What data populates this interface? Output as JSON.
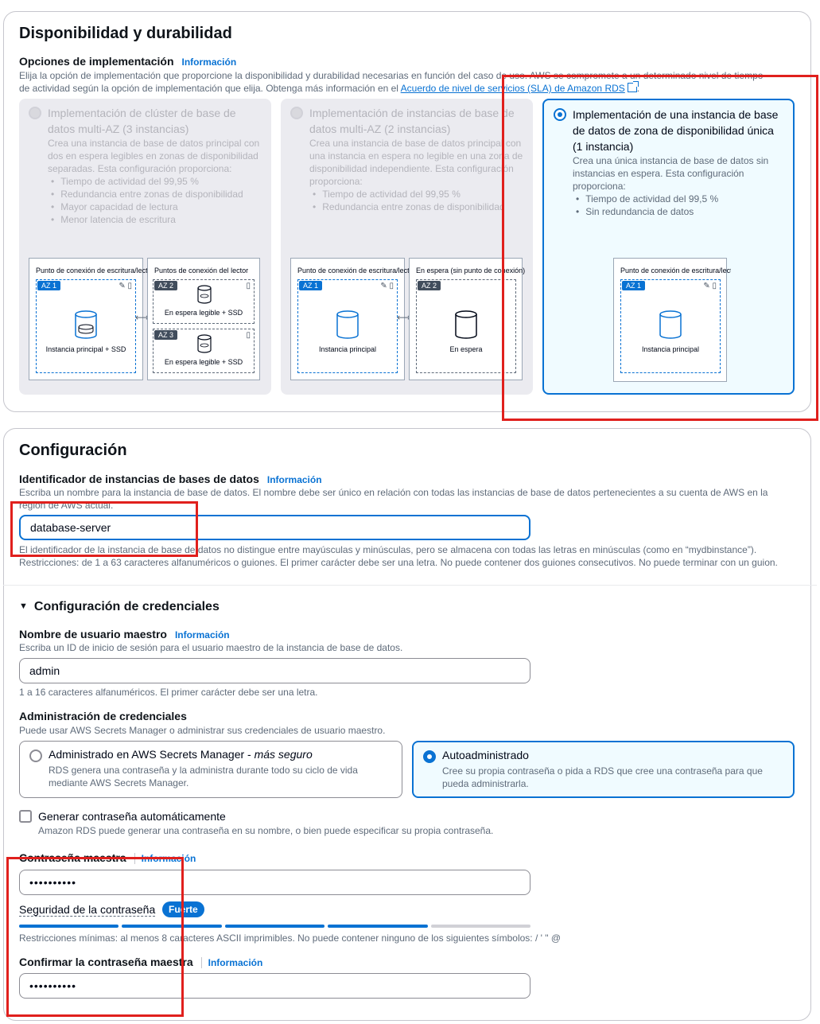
{
  "availability": {
    "title": "Disponibilidad y durabilidad",
    "deploy_label": "Opciones de implementación",
    "info": "Información",
    "desc_1": "Elija la opción de implementación que proporcione la disponibilidad y durabilidad necesarias en función del caso de uso. AWS se compromete a un determinado nivel de tiempo",
    "desc_2": "de actividad según la opción de implementación que elija. Obtenga más información en el",
    "sla_link": "Acuerdo de nivel de servicios (SLA) de Amazon RDS",
    "options": [
      {
        "title": "Implementación de clúster de base de datos multi-AZ (3 instancias)",
        "desc": "Crea una instancia de base de datos principal con dos en espera legibles en zonas de disponibilidad separadas. Esta configuración proporciona:",
        "bullets": [
          "Tiempo de actividad del 99,95 %",
          "Redundancia entre zonas de disponibilidad",
          "Mayor capacidad de lectura",
          "Menor latencia de escritura"
        ],
        "diagram": {
          "writer_title": "Punto de conexión de escritura/lectura",
          "reader_title": "Puntos de conexión del lector",
          "az1": "AZ 1",
          "az2": "AZ 2",
          "az3": "AZ 3",
          "primary": "Instancia principal + SSD",
          "standby_a": "En espera legible + SSD",
          "standby_b": "En espera legible + SSD"
        }
      },
      {
        "title": "Implementación de instancias de base de datos multi-AZ (2 instancias)",
        "desc": "Crea una instancia de base de datos principal con una instancia en espera no legible en una zona de disponibilidad independiente. Esta configuración proporciona:",
        "bullets": [
          "Tiempo de actividad del 99,95 %",
          "Redundancia entre zonas de disponibilidad"
        ],
        "diagram": {
          "writer_title": "Punto de conexión de escritura/lectura",
          "standby_title": "En espera (sin punto de conexión)",
          "az1": "AZ 1",
          "az2": "AZ 2",
          "primary": "Instancia principal",
          "standby": "En espera"
        }
      },
      {
        "title": "Implementación de una instancia de base de datos de zona de disponibilidad única (1 instancia)",
        "desc": "Crea una única instancia de base de datos sin instancias en espera. Esta configuración proporciona:",
        "bullets": [
          "Tiempo de actividad del 99,5 %",
          "Sin redundancia de datos"
        ],
        "diagram": {
          "writer_title": "Punto de conexión de escritura/lectura",
          "az1": "AZ 1",
          "primary": "Instancia principal"
        }
      }
    ]
  },
  "config": {
    "title": "Configuración",
    "identifier_label": "Identificador de instancias de bases de datos",
    "info": "Información",
    "identifier_desc": "Escriba un nombre para la instancia de base de datos. El nombre debe ser único en relación con todas las instancias de base de datos pertenecientes a su cuenta de AWS en la región de AWS actual.",
    "identifier_value": "database-server",
    "identifier_hint_1": "El identificador de la instancia de base de datos no distingue entre mayúsculas y minúsculas, pero se almacena con todas las letras en minúsculas (como en “mydbinstance”).",
    "identifier_hint_2": "Restricciones: de 1 a 63 caracteres alfanuméricos o guiones. El primer carácter debe ser una letra. No puede contener dos guiones consecutivos. No puede terminar con un guion.",
    "credentials_title": "Configuración de credenciales",
    "master_user_label": "Nombre de usuario maestro",
    "master_user_desc": "Escriba un ID de inicio de sesión para el usuario maestro de la instancia de base de datos.",
    "master_user_value": "admin",
    "master_user_hint": "1 a 16 caracteres alfanuméricos. El primer carácter debe ser una letra.",
    "cred_mgmt_label": "Administración de credenciales",
    "cred_mgmt_desc": "Puede usar AWS Secrets Manager o administrar sus credenciales de usuario maestro.",
    "tile_secrets_title": "Administrado en AWS Secrets Manager - ",
    "tile_secrets_emph": "más seguro",
    "tile_secrets_desc": "RDS genera una contraseña y la administra durante todo su ciclo de vida mediante AWS Secrets Manager.",
    "tile_self_title": "Autoadministrado",
    "tile_self_desc": "Cree su propia contraseña o pida a RDS que cree una contraseña para que pueda administrarla.",
    "auto_pw_label": "Generar contraseña automáticamente",
    "auto_pw_desc": "Amazon RDS puede generar una contraseña en su nombre, o bien puede especificar su propia contraseña.",
    "master_pw_label": "Contraseña maestra",
    "master_pw_value": "••••••••••",
    "strength_label": "Seguridad de la contraseña",
    "strength_badge": "Fuerte",
    "strength_level": 0.8,
    "pw_restrictions": "Restricciones mínimas: al menos 8 caracteres ASCII imprimibles. No puede contener ninguno de los siguientes símbolos: / ' \" @",
    "confirm_pw_label": "Confirmar la contraseña maestra",
    "confirm_pw_value": "••••••••••"
  }
}
